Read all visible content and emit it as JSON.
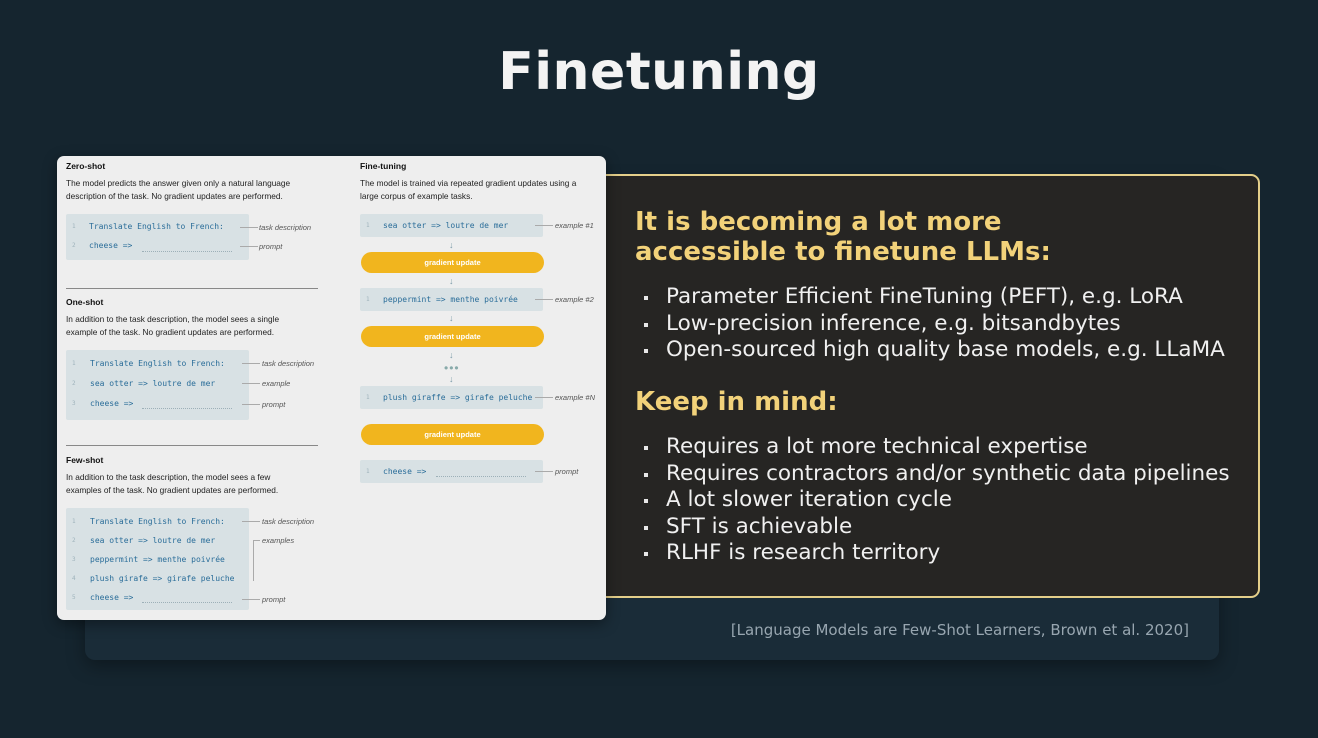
{
  "slide": {
    "title": "Finetuning",
    "citation": "[Language Models are Few-Shot Learners, Brown et al. 2020]"
  },
  "info": {
    "heading1": [
      "It is becoming a lot more",
      "accessible to finetune LLMs:"
    ],
    "bullets1": [
      "Parameter Efficient FineTuning (PEFT), e.g. LoRA",
      "Low-precision inference, e.g. bitsandbytes",
      "Open-sourced high quality base models, e.g. LLaMA"
    ],
    "heading2": "Keep in mind:",
    "bullets2": [
      "Requires a lot more technical expertise",
      "Requires contractors and/or synthetic data pipelines",
      "A lot slower iteration cycle",
      "SFT is achievable",
      "RLHF is research territory"
    ]
  },
  "figure": {
    "zero_shot": {
      "title": "Zero-shot",
      "desc": "The model predicts the answer given only a natural language description of the task. No gradient updates are performed.",
      "lines": [
        "Translate English to French:",
        "cheese =>"
      ],
      "annotations": [
        "task description",
        "prompt"
      ]
    },
    "one_shot": {
      "title": "One-shot",
      "desc": "In addition to the task description, the model sees a single example of the task. No gradient updates are performed.",
      "lines": [
        "Translate English to French:",
        "sea otter => loutre de mer",
        "cheese =>"
      ],
      "annotations": [
        "task description",
        "example",
        "prompt"
      ]
    },
    "few_shot": {
      "title": "Few-shot",
      "desc": "In addition to the task description, the model sees a few examples of the task. No gradient updates are performed.",
      "lines": [
        "Translate English to French:",
        "sea otter => loutre de mer",
        "peppermint => menthe poivrée",
        "plush girafe => girafe peluche",
        "cheese =>"
      ],
      "annotations": [
        "task description",
        "examples",
        "prompt"
      ]
    },
    "fine_tuning": {
      "title": "Fine-tuning",
      "desc": "The model is trained via repeated gradient updates using a large corpus of example tasks.",
      "examples": [
        "sea otter => loutre de mer",
        "peppermint => menthe poivrée",
        "plush giraffe => girafe peluche"
      ],
      "example_labels": [
        "example #1",
        "example #2",
        "example #N"
      ],
      "gradient_label": "gradient update",
      "prompt_line": "cheese =>",
      "prompt_label": "prompt"
    },
    "line_numbers": [
      "1",
      "2",
      "3",
      "4",
      "5"
    ]
  }
}
